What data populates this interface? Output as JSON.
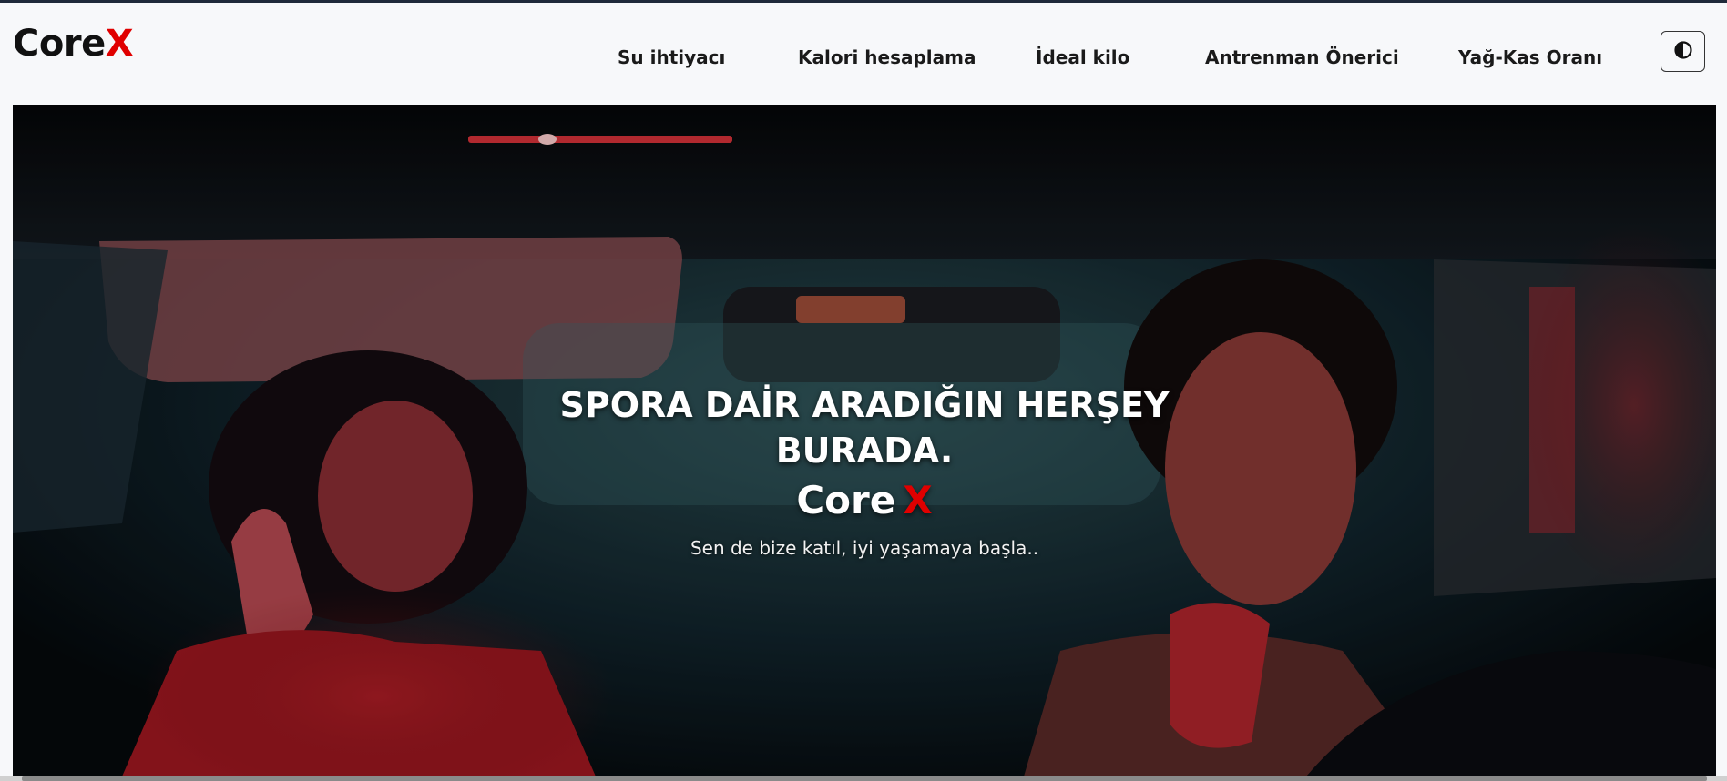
{
  "header": {
    "logo_main": "Core",
    "logo_accent": "X",
    "nav": [
      {
        "label": "Su ihtiyacı"
      },
      {
        "label": "Kalori hesaplama"
      },
      {
        "label": "İdeal kilo"
      },
      {
        "label": "Antrenman Önerici"
      },
      {
        "label": "Yağ-Kas Oranı"
      }
    ],
    "theme_toggle_icon": "contrast-icon"
  },
  "hero": {
    "headline": "SPORA DAİR ARADIĞIN HERŞEY BURADA.",
    "brand_main": "Core",
    "brand_accent": "X",
    "tagline": "Sen de bize katıl, iyi yaşamaya başla.."
  },
  "colors": {
    "accent": "#e00000",
    "text_dark": "#1a1a1a",
    "navbar_bg": "#f7f8fa"
  }
}
